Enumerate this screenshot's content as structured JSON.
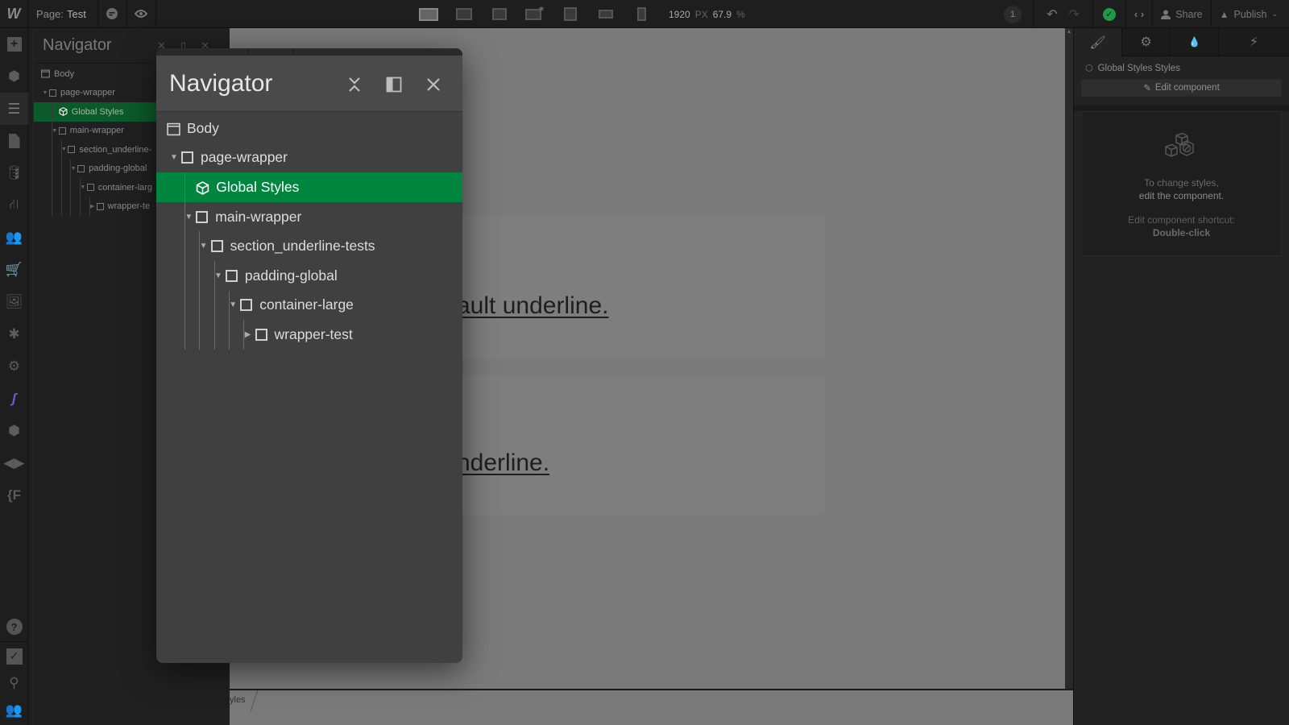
{
  "topbar": {
    "logo": "W",
    "page_prefix": "Page:",
    "page_name": "Test",
    "breakpoints": [
      {
        "name": "desktop-base",
        "active": true
      },
      {
        "name": "large-desktop",
        "active": false
      },
      {
        "name": "desktop",
        "active": false
      },
      {
        "name": "laptop-starred",
        "active": false
      },
      {
        "name": "tablet",
        "active": false
      },
      {
        "name": "mobile-landscape",
        "active": false
      },
      {
        "name": "mobile-portrait",
        "active": false
      }
    ],
    "width_value": "1920",
    "width_unit": "PX",
    "zoom_value": "67.9",
    "zoom_unit": "%",
    "notification_count": "1",
    "share_label": "Share",
    "publish_label": "Publish",
    "status": "saved",
    "status_color": "#1f9a45"
  },
  "rail": {
    "top": [
      "add-icon",
      "components-box-icon",
      "navigator-icon",
      "pages-icon",
      "cms-database-icon",
      "logic-flow-icon",
      "users-icon",
      "ecommerce-cart-icon",
      "assets-images-icon",
      "apps-puzzle-icon",
      "settings-gear-icon",
      "finsweet-attributes-icon",
      "box-3d-icon",
      "relume-icon",
      "fonts-f-icon"
    ],
    "bottom": [
      "help-icon",
      "audit-checklist-icon",
      "search-icon",
      "collaborators-icon"
    ]
  },
  "navigator_docked": {
    "title": "Navigator",
    "items": [
      {
        "label": "Body",
        "depth": 0,
        "type": "body"
      },
      {
        "label": "page-wrapper",
        "depth": 0,
        "type": "div",
        "expanded": true
      },
      {
        "label": "Global Styles",
        "depth": 1,
        "type": "component",
        "selected": true
      },
      {
        "label": "main-wrapper",
        "depth": 1,
        "type": "div",
        "expanded": true
      },
      {
        "label": "section_underline-",
        "depth": 2,
        "type": "div",
        "expanded": true
      },
      {
        "label": "padding-global",
        "depth": 3,
        "type": "div",
        "expanded": true
      },
      {
        "label": "container-larg",
        "depth": 4,
        "type": "div",
        "expanded": true
      },
      {
        "label": "wrapper-te",
        "depth": 5,
        "type": "div",
        "expanded": false
      }
    ]
  },
  "navigator_float": {
    "title": "Navigator",
    "items": [
      {
        "label": "Body",
        "depth": 0,
        "type": "body"
      },
      {
        "label": "page-wrapper",
        "depth": 0,
        "type": "div",
        "expanded": true
      },
      {
        "label": "Global Styles",
        "depth": 1,
        "type": "component",
        "selected": true
      },
      {
        "label": "main-wrapper",
        "depth": 1,
        "type": "div",
        "expanded": true
      },
      {
        "label": "section_underline-tests",
        "depth": 2,
        "type": "div",
        "expanded": true
      },
      {
        "label": "padding-global",
        "depth": 3,
        "type": "div",
        "expanded": true
      },
      {
        "label": "container-large",
        "depth": 4,
        "type": "div",
        "expanded": true
      },
      {
        "label": "wrapper-test",
        "depth": 5,
        "type": "div",
        "expanded": false
      }
    ],
    "selected_color": "#00853f"
  },
  "canvas": {
    "cards": [
      {
        "text": "ault underline."
      },
      {
        "text": "nderline."
      }
    ],
    "breadcrumb": "yles"
  },
  "right_panel": {
    "tabs": [
      {
        "name": "style-brush-icon",
        "active": true
      },
      {
        "name": "settings-gear-icon",
        "active": false
      },
      {
        "name": "style-manager-drops-icon",
        "active": false
      },
      {
        "name": "interactions-bolt-icon",
        "active": false
      }
    ],
    "selector_label": "Global Styles Styles",
    "edit_button": "Edit component",
    "info_line1": "To change styles,",
    "info_line2": "edit the component.",
    "shortcut_label": "Edit component shortcut:",
    "shortcut_value": "Double-click"
  }
}
